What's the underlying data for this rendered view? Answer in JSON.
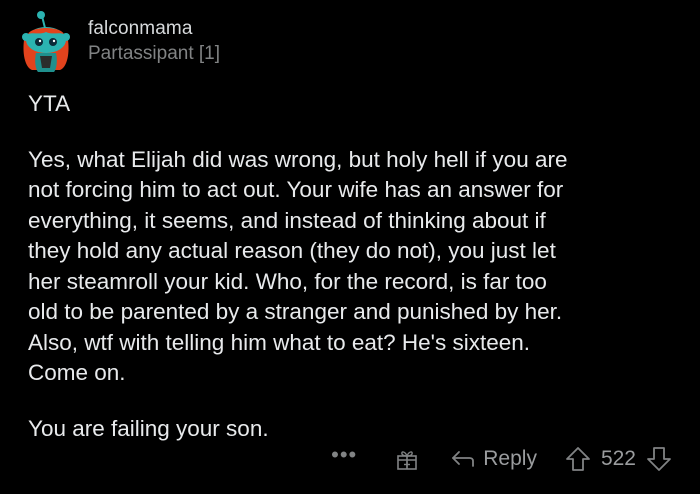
{
  "comment": {
    "username": "falconmama",
    "flair": "Partassipant [1]",
    "paragraphs": [
      "YTA",
      "Yes, what Elijah did was wrong, but holy hell if you are\nnot forcing him to act out. Your wife has an answer for\neverything, it seems, and instead of thinking about if\nthey hold any actual reason (they do not), you just let\nher steamroll your kid. Who, for the record, is far too\nold to be parented by a stranger and punished by her.\nAlso, wtf with telling him what to eat? He's sixteen.\nCome on.",
      "You are failing your son."
    ]
  },
  "actions": {
    "more": "•••",
    "reply_label": "Reply",
    "vote_count": "522"
  },
  "icons": {
    "more": "more-options-icon",
    "award": "award-gift-icon",
    "reply": "reply-arrow-icon",
    "upvote": "upvote-arrow-icon",
    "downvote": "downvote-arrow-icon"
  },
  "colors": {
    "background": "#000000",
    "text": "#d7dadc",
    "muted": "#818384",
    "avatar_teal": "#2bb3b1",
    "avatar_hair": "#e2431d"
  }
}
